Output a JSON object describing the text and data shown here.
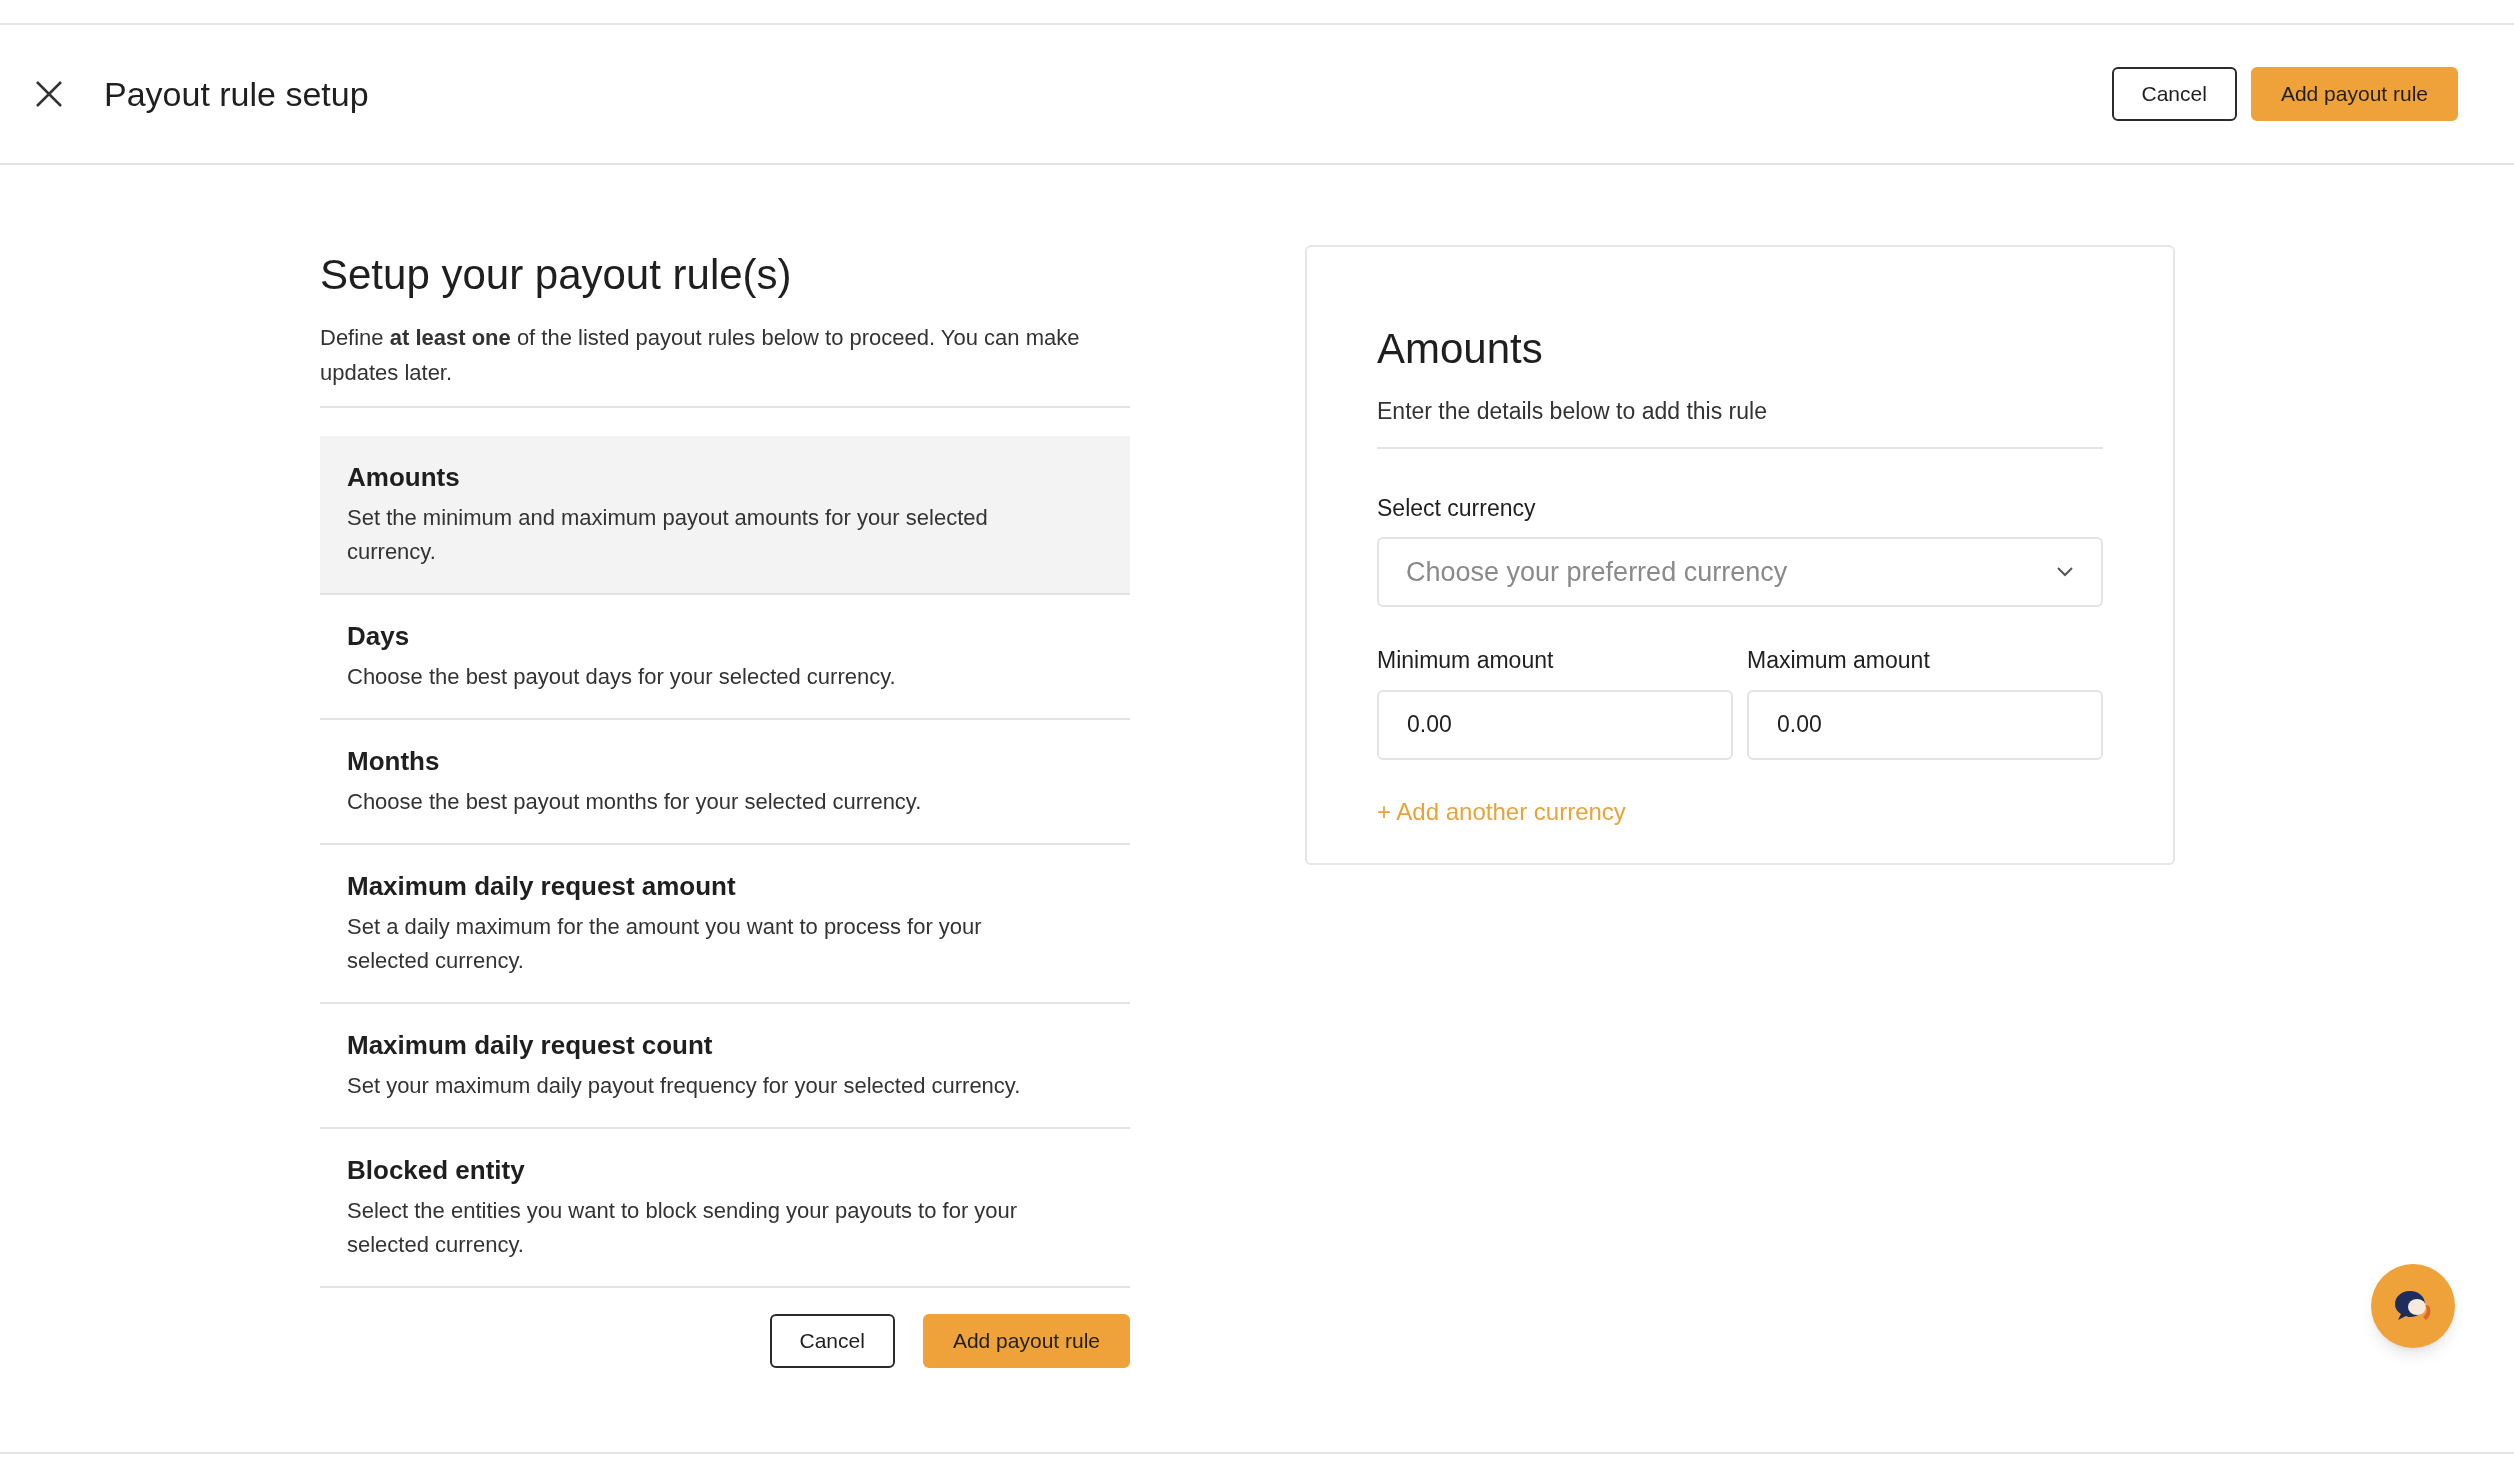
{
  "header": {
    "title": "Payout rule setup",
    "buttons": [
      {
        "label": "Cancel",
        "kind": "secondary"
      },
      {
        "label": "Add payout rule",
        "kind": "primary"
      }
    ]
  },
  "intro": {
    "title": "Setup your payout rule(s)",
    "description": "Define **at least one** of the listed payout rules below to proceed. You can make updates later."
  },
  "rules": [
    {
      "title": "Amounts",
      "description": "Set the minimum and maximum payout amounts for your selected currency.",
      "selected": true
    },
    {
      "title": "Days",
      "description": "Choose the best payout days for your selected currency.",
      "selected": false
    },
    {
      "title": "Months",
      "description": "Choose the best payout months for your selected currency.",
      "selected": false
    },
    {
      "title": "Maximum daily request amount",
      "description": "Set a daily maximum for the amount you want to process for your selected currency.",
      "selected": false
    },
    {
      "title": "Maximum daily request count",
      "description": "Set your maximum daily payout frequency for your selected currency.",
      "selected": false
    },
    {
      "title": "Blocked entity",
      "description": "Select the entities you want to block sending your payouts to for your selected currency.",
      "selected": false
    }
  ],
  "footer_buttons": [
    {
      "label": "Cancel",
      "kind": "secondary"
    },
    {
      "label": "Add payout rule",
      "kind": "primary"
    }
  ],
  "panel": {
    "title": "Amounts",
    "subtitle": "Enter the details below to add this rule",
    "currency": {
      "label": "Select currency",
      "placeholder": "Choose your preferred currency"
    },
    "fields": [
      {
        "label": "Minimum amount",
        "value": "0.00"
      },
      {
        "label": "Maximum amount",
        "value": "0.00"
      }
    ],
    "link": "+ Add another currency"
  }
}
